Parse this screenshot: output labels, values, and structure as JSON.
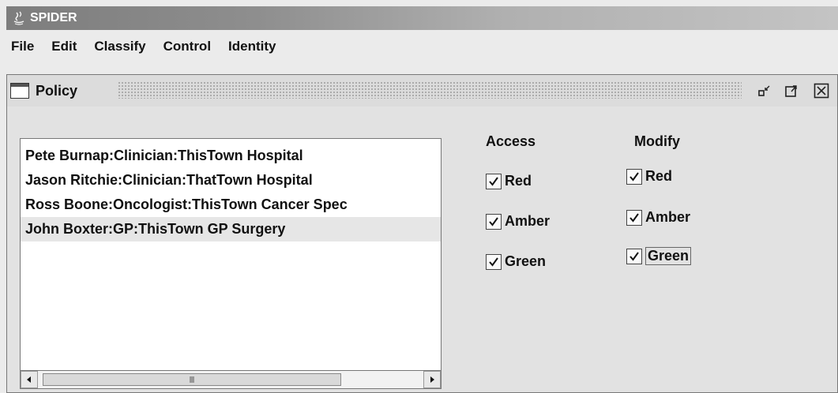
{
  "window": {
    "title": "SPIDER"
  },
  "menubar": {
    "items": [
      "File",
      "Edit",
      "Classify",
      "Control",
      "Identity"
    ]
  },
  "frame": {
    "title": "Policy"
  },
  "list": {
    "items": [
      "Pete Burnap:Clinician:ThisTown Hospital",
      "Jason Ritchie:Clinician:ThatTown Hospital",
      "Ross Boone:Oncologist:ThisTown Cancer Spec",
      "John Boxter:GP:ThisTown GP Surgery"
    ],
    "selected_index": 3
  },
  "access": {
    "header": "Access",
    "options": [
      {
        "label": "Red",
        "checked": true
      },
      {
        "label": "Amber",
        "checked": true
      },
      {
        "label": "Green",
        "checked": true
      }
    ]
  },
  "modify": {
    "header": "Modify",
    "options": [
      {
        "label": "Red",
        "checked": true
      },
      {
        "label": "Amber",
        "checked": true
      },
      {
        "label": "Green",
        "checked": true
      }
    ]
  },
  "icons": {
    "app": "java-icon",
    "frame": "window-icon",
    "iconify": "minimize-icon",
    "maximize": "maximize-icon",
    "close": "close-icon"
  }
}
